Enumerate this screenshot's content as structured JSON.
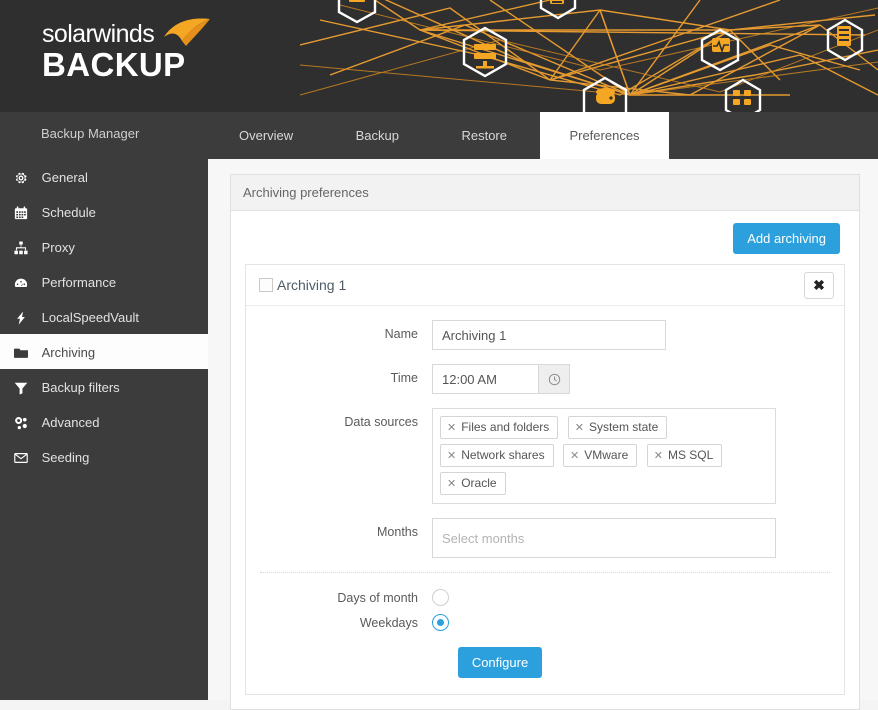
{
  "banner": {
    "logo_word": "solarwinds",
    "logo_product": "BACKUP",
    "art_icon_names": [
      "server-node-icon",
      "database-node-icon",
      "rack-node-icon",
      "monitor-pulse-node-icon",
      "clipboard-node-icon",
      "network-ports-node-icon",
      "disk-node-icon"
    ]
  },
  "nav": {
    "brand_label": "Backup Manager",
    "tabs": [
      {
        "label": "Overview",
        "active": false
      },
      {
        "label": "Backup",
        "active": false
      },
      {
        "label": "Restore",
        "active": false
      },
      {
        "label": "Preferences",
        "active": true
      }
    ]
  },
  "sidebar": {
    "items": [
      {
        "label": "General",
        "icon": "gear-icon",
        "active": false
      },
      {
        "label": "Schedule",
        "icon": "calendar-icon",
        "active": false
      },
      {
        "label": "Proxy",
        "icon": "sitemap-icon",
        "active": false
      },
      {
        "label": "Performance",
        "icon": "gauge-icon",
        "active": false
      },
      {
        "label": "LocalSpeedVault",
        "icon": "bolt-icon",
        "active": false
      },
      {
        "label": "Archiving",
        "icon": "folder-icon",
        "active": true
      },
      {
        "label": "Backup filters",
        "icon": "funnel-icon",
        "active": false
      },
      {
        "label": "Advanced",
        "icon": "gears-icon",
        "active": false
      },
      {
        "label": "Seeding",
        "icon": "envelope-icon",
        "active": false
      }
    ]
  },
  "main": {
    "panel_title": "Archiving preferences",
    "add_archiving_label": "Add archiving",
    "archiving": {
      "title": "Archiving 1",
      "checked": false,
      "close_label": "✖",
      "fields": {
        "name_label": "Name",
        "name_value": "Archiving 1",
        "time_label": "Time",
        "time_value": "12:00 AM",
        "time_button_icon": "clock-icon",
        "data_sources_label": "Data sources",
        "data_sources": [
          "Files and folders",
          "System state",
          "Network shares",
          "VMware",
          "MS SQL",
          "Oracle"
        ],
        "tag_remove_glyph": "✕",
        "months_label": "Months",
        "months_value": "",
        "months_placeholder": "Select months"
      },
      "schedule": {
        "days_of_month_label": "Days of month",
        "days_of_month_selected": false,
        "weekdays_label": "Weekdays",
        "weekdays_selected": true,
        "configure_label": "Configure"
      }
    }
  },
  "colors": {
    "accent_blue": "#2ba0dd",
    "brand_orange": "#f5a623",
    "dark_chrome": "#3c3c3c",
    "banner_dark": "#2f2f2f"
  }
}
